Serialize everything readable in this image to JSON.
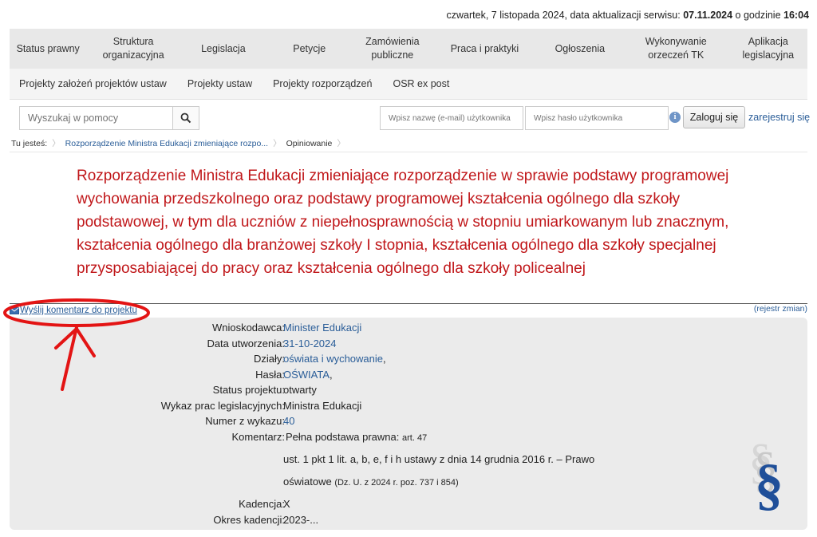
{
  "top": {
    "date_text": "czwartek, 7 listopada 2024, data aktualizacji serwisu: ",
    "update_date": "07.11.2024",
    "at_text": " o godzinie ",
    "update_time": "16:04"
  },
  "main_nav": [
    "Status prawny",
    "Struktura organizacyjna",
    "Legislacja",
    "Petycje",
    "Zamówienia publiczne",
    "Praca i praktyki",
    "Ogłoszenia",
    "Wykonywanie orzeczeń TK",
    "Aplikacja legislacyjna"
  ],
  "sub_nav": [
    "Projekty założeń projektów ustaw",
    "Projekty ustaw",
    "Projekty rozporządzeń",
    "OSR ex post"
  ],
  "search": {
    "placeholder": "Wyszukaj w pomocy"
  },
  "login": {
    "user_placeholder": "Wpisz nazwę (e-mail) użytkownika",
    "pass_placeholder": "Wpisz hasło użytkownika",
    "login_label": "Zaloguj się",
    "register_label": "zarejestruj się",
    "info_glyph": "i"
  },
  "breadcrumb": {
    "prefix": "Tu jesteś:",
    "item1": "Rozporządzenie Ministra Edukacji zmieniające rozpo...",
    "item2": "Opiniowanie"
  },
  "title": "Rozporządzenie Ministra Edukacji zmieniające rozporządzenie w sprawie podstawy programowej wychowania przedszkolnego oraz podstawy programowej kształcenia ogólnego dla szkoły podstawowej, w tym dla uczniów z niepełnosprawnością w stopniu umiarkowanym lub znacznym, kształcenia ogólnego dla branżowej szkoły I stopnia, kształcenia ogólnego dla szkoły specjalnej przysposabiającej do pracy oraz kształcenia ogólnego dla szkoły policealnej",
  "actions": {
    "send_comment": "Wyślij komentarz do projektu",
    "registry": "(rejestr zmian)"
  },
  "details": {
    "applicant_label": "Wnioskodawca:",
    "applicant": "Minister Edukacji",
    "created_label": "Data utworzenia:",
    "created": "31-10-2024",
    "departments_label": "Działy:",
    "departments": "oświata i wychowanie",
    "departments_suffix": ",",
    "keywords_label": "Hasła:",
    "keywords": "OŚWIATA",
    "keywords_suffix": ",",
    "status_label": "Status projektu:",
    "status": "otwarty",
    "worklist_label": "Wykaz prac legislacyjnych:",
    "worklist": "Ministra Edukacji",
    "number_label": "Numer z wykazu:",
    "number": "40",
    "comment_label": "Komentarz:",
    "comment_heading": "Pełna podstawa prawna:",
    "comment_art": "art. 47",
    "comment_line2": "ust. 1 pkt 1 lit. a, b, e, f i h ustawy z dnia 14 grudnia 2016 r. – Prawo",
    "comment_line3a": "oświatowe",
    "comment_line3b": "(Dz. U. z 2024 r. poz. 737 i 854)",
    "term_label": "Kadencja:",
    "term": "X",
    "term_period_label": "Okres kadencji:",
    "term_period": "2023-..."
  },
  "logo": {
    "glyph": "§"
  },
  "colors": {
    "title_red": "#c0171a",
    "link_blue": "#2a5d98",
    "annotation_red": "#e31414"
  }
}
